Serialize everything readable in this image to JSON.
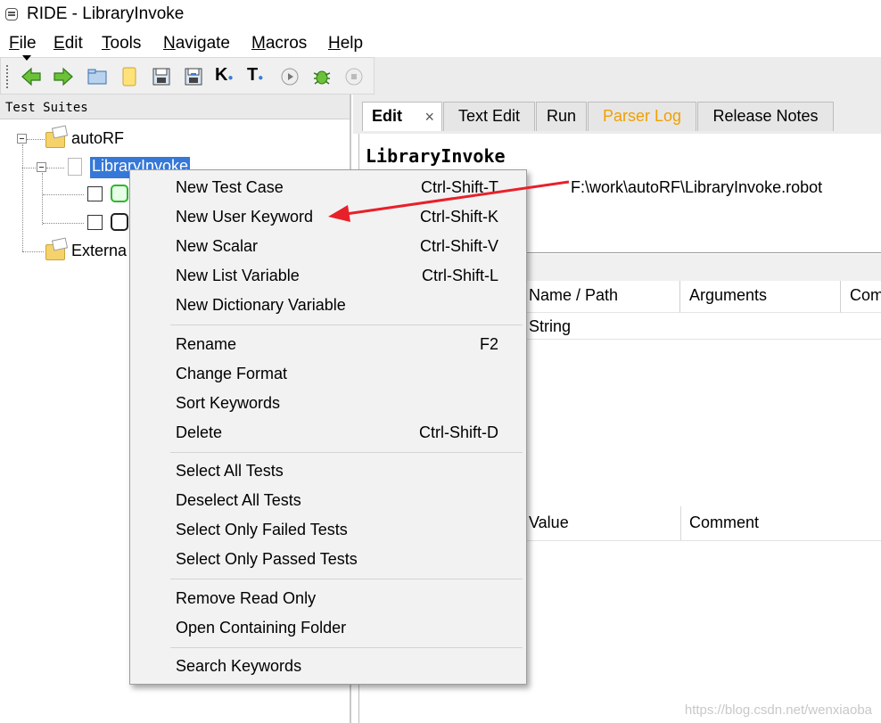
{
  "window": {
    "title": "RIDE - LibraryInvoke"
  },
  "menubar": {
    "items": [
      {
        "key": "F",
        "rest": "ile"
      },
      {
        "key": "E",
        "rest": "dit"
      },
      {
        "key": "T",
        "rest": "ools"
      },
      {
        "key": "N",
        "rest": "avigate"
      },
      {
        "key": "M",
        "rest": "acros"
      },
      {
        "key": "H",
        "rest": "elp"
      }
    ]
  },
  "toolbar": {
    "buttons": [
      "back-arrow-icon",
      "forward-arrow-icon",
      "open-folder-icon",
      "new-page-icon",
      "save-icon",
      "save-all-icon",
      "search-keyword-icon",
      "search-test-icon",
      "run-icon",
      "debug-bug-icon",
      "stop-icon"
    ],
    "k_glyph": "K",
    "t_glyph": "T"
  },
  "left_panel": {
    "header": "Test Suites",
    "tree": {
      "root": "autoRF",
      "suite": "LibraryInvoke",
      "external": "Externa"
    }
  },
  "tabs": [
    {
      "label": "Edit",
      "active": true,
      "close": "×"
    },
    {
      "label": "Text Edit"
    },
    {
      "label": "Run"
    },
    {
      "label": "Parser Log",
      "color": "#f0a000"
    },
    {
      "label": "Release Notes"
    }
  ],
  "editor": {
    "suite_name": "LibraryInvoke",
    "path": "F:\\work\\autoRF\\LibraryInvoke.robot",
    "imports_columns": [
      "Name / Path",
      "Arguments",
      "Com"
    ],
    "imports_row": [
      "String"
    ],
    "variables_columns": [
      "Value",
      "Comment"
    ]
  },
  "context_menu": {
    "groups": [
      [
        {
          "label": "New Test Case",
          "shortcut": "Ctrl-Shift-T"
        },
        {
          "label": "New User Keyword",
          "shortcut": "Ctrl-Shift-K"
        },
        {
          "label": "New Scalar",
          "shortcut": "Ctrl-Shift-V"
        },
        {
          "label": "New List Variable",
          "shortcut": "Ctrl-Shift-L"
        },
        {
          "label": "New Dictionary Variable",
          "shortcut": ""
        }
      ],
      [
        {
          "label": "Rename",
          "shortcut": "F2"
        },
        {
          "label": "Change Format",
          "shortcut": ""
        },
        {
          "label": "Sort Keywords",
          "shortcut": ""
        },
        {
          "label": "Delete",
          "shortcut": "Ctrl-Shift-D"
        }
      ],
      [
        {
          "label": "Select All Tests",
          "shortcut": ""
        },
        {
          "label": "Deselect All Tests",
          "shortcut": ""
        },
        {
          "label": "Select Only Failed Tests",
          "shortcut": ""
        },
        {
          "label": "Select Only Passed Tests",
          "shortcut": ""
        }
      ],
      [
        {
          "label": "Remove Read Only",
          "shortcut": ""
        },
        {
          "label": "Open Containing Folder",
          "shortcut": ""
        }
      ],
      [
        {
          "label": "Search Keywords",
          "shortcut": ""
        }
      ]
    ]
  },
  "annotation": {
    "arrow_color": "#e8202a"
  },
  "watermark": "https://blog.csdn.net/wenxiaoba"
}
